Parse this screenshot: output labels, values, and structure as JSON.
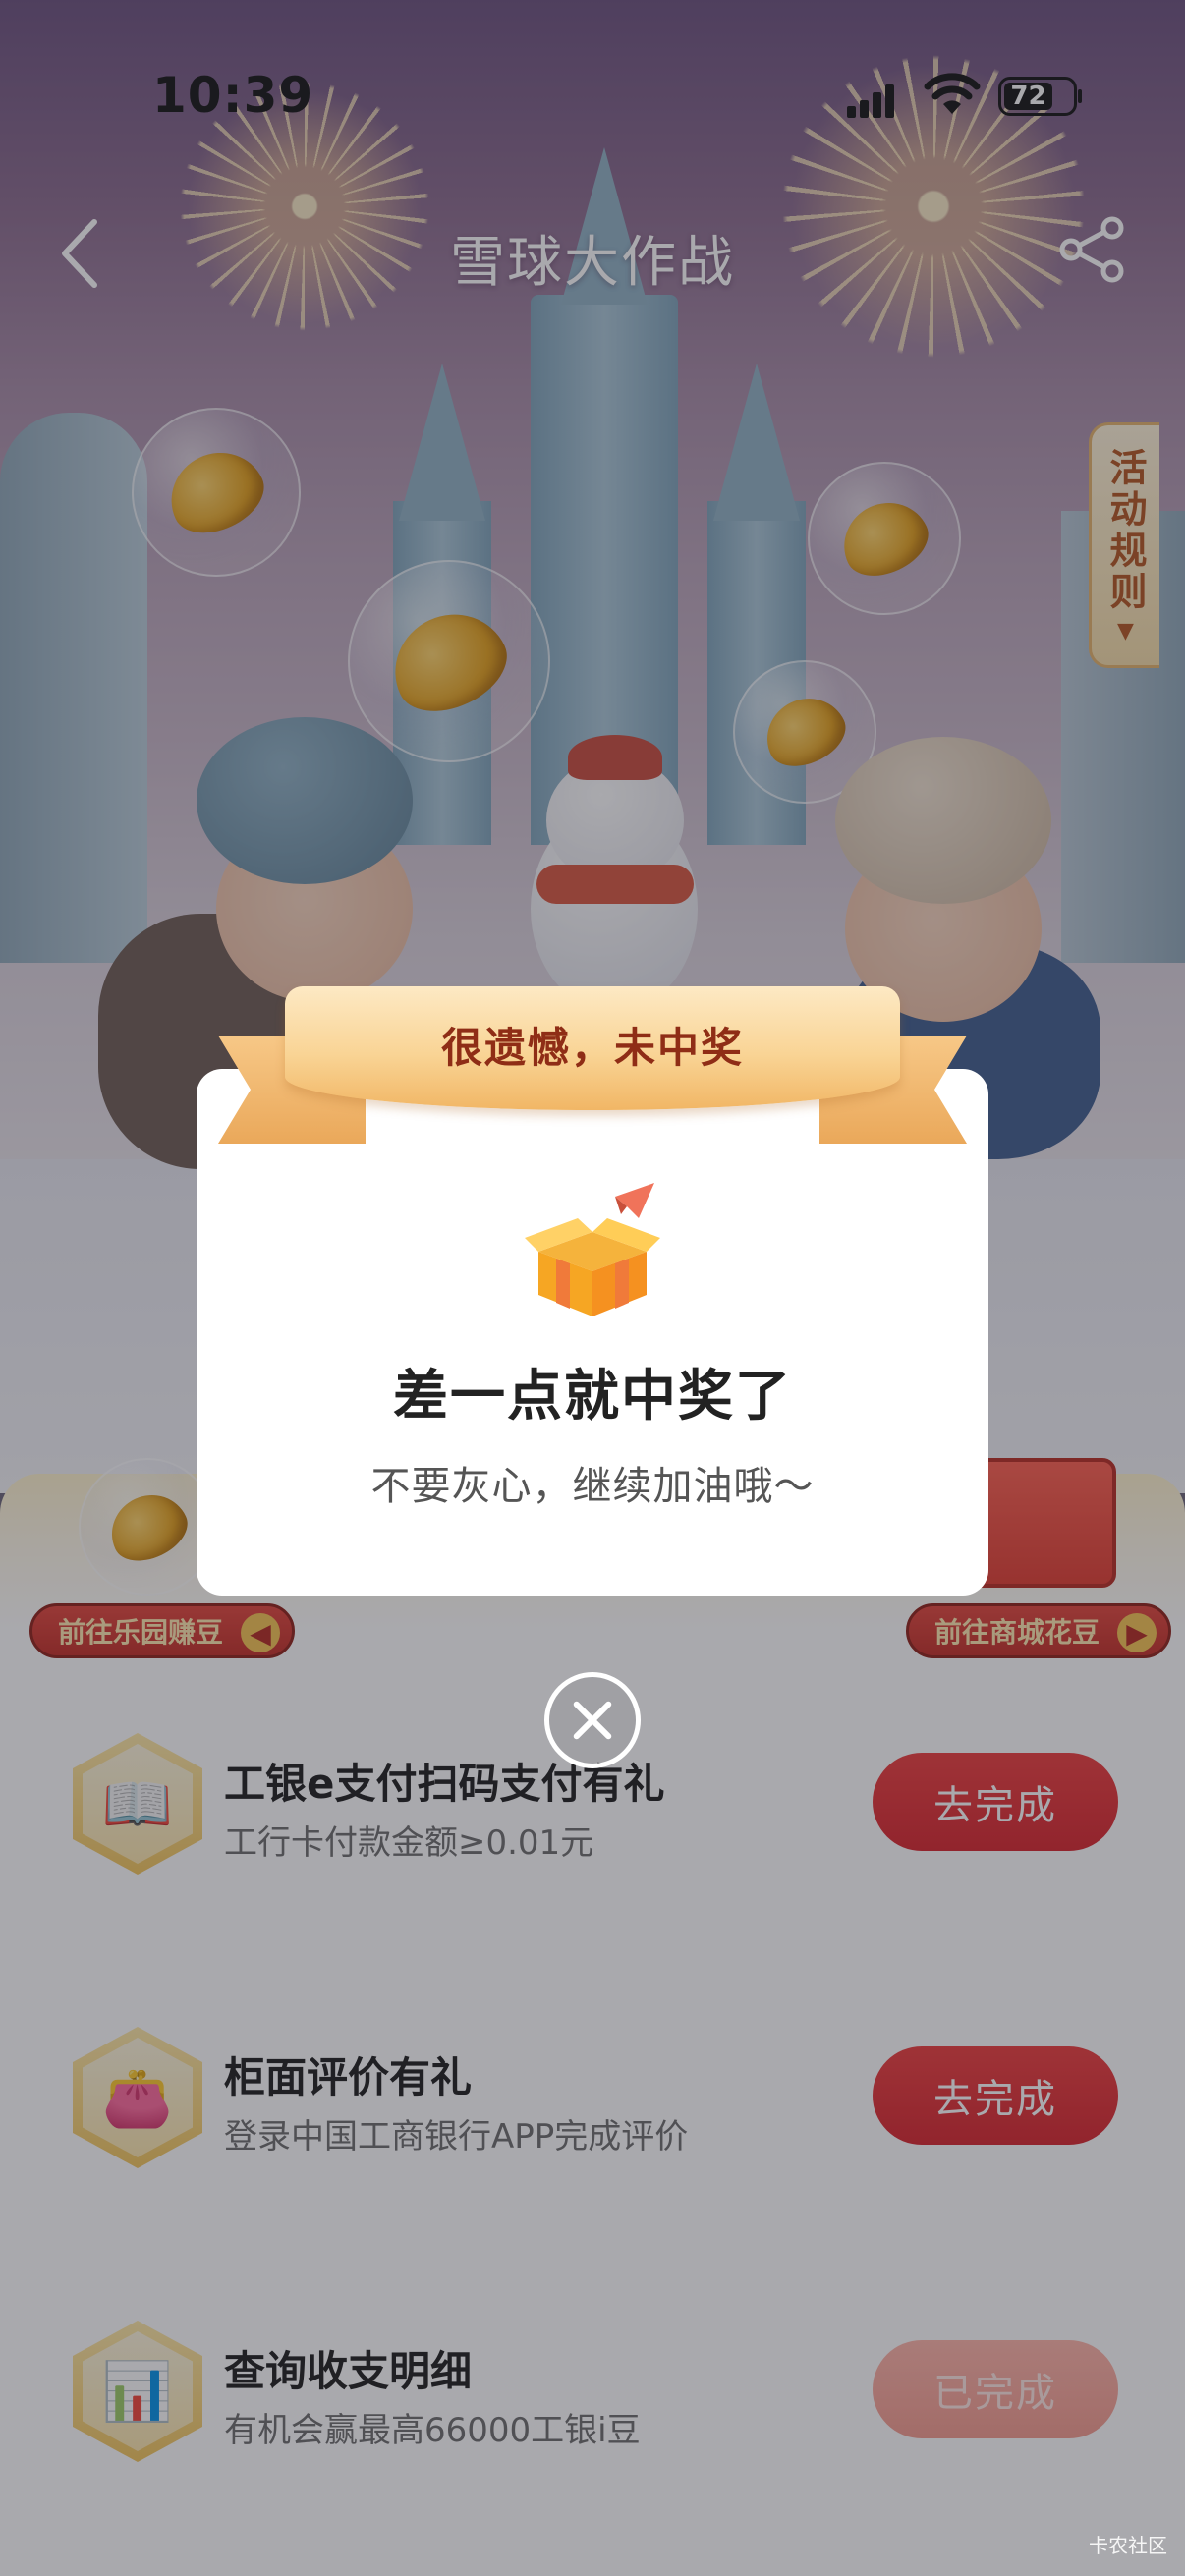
{
  "status_bar": {
    "time": "10:39",
    "battery_level": "72"
  },
  "nav": {
    "title": "雪球大作战",
    "back_icon": "chevron-left-icon",
    "share_icon": "share-icon"
  },
  "rules_tab": {
    "label": "活动规则",
    "arrow": "▼"
  },
  "shortcuts": {
    "left_label": "前往乐园赚豆",
    "right_label": "前往商城花豆",
    "left_arrow": "◀",
    "right_arrow": "▶"
  },
  "tasks": [
    {
      "title": "工银e支付扫码支付有礼",
      "subtitle": "工行卡付款金额≥0.01元",
      "button": "去完成",
      "icon": "book-icon",
      "done": false
    },
    {
      "title": "柜面评价有礼",
      "subtitle": "登录中国工商银行APP完成评价",
      "button": "去完成",
      "icon": "purse-icon",
      "done": false
    },
    {
      "title": "查询收支明细",
      "subtitle": "有机会赢最高66000工银i豆",
      "button": "已完成",
      "icon": "chart-icon",
      "done": true
    }
  ],
  "modal": {
    "ribbon_text": "很遗憾，未中奖",
    "title": "差一点就中奖了",
    "subtitle": "不要灰心，继续加油哦～",
    "icon": "open-box-icon",
    "close_icon": "close-circle-icon"
  },
  "watermark": "卡农社区",
  "colors": {
    "accent_red": "#d8222a",
    "ribbon_gold": "#f9d495",
    "ribbon_text": "#8f2d16"
  }
}
